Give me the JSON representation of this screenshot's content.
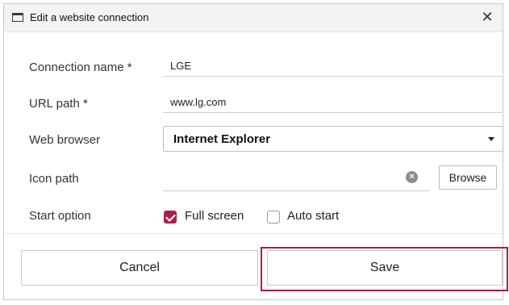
{
  "dialog": {
    "title": "Edit a website connection",
    "close_glyph": "✕",
    "title_icon": "window-icon"
  },
  "form": {
    "connection_name": {
      "label": "Connection name *",
      "value": "LGE"
    },
    "url_path": {
      "label": "URL path *",
      "value": "www.lg.com"
    },
    "web_browser": {
      "label": "Web browser",
      "selected": "Internet Explorer"
    },
    "icon_path": {
      "label": "Icon path",
      "value": "",
      "browse_label": "Browse",
      "clear_icon": "clear-icon"
    },
    "start_option": {
      "label": "Start option",
      "options": [
        {
          "label": "Full screen",
          "checked": true
        },
        {
          "label": "Auto start",
          "checked": false
        }
      ]
    }
  },
  "actions": {
    "cancel_label": "Cancel",
    "save_label": "Save"
  },
  "colors": {
    "accent": "#a8204a",
    "highlight": "#b11a46"
  }
}
